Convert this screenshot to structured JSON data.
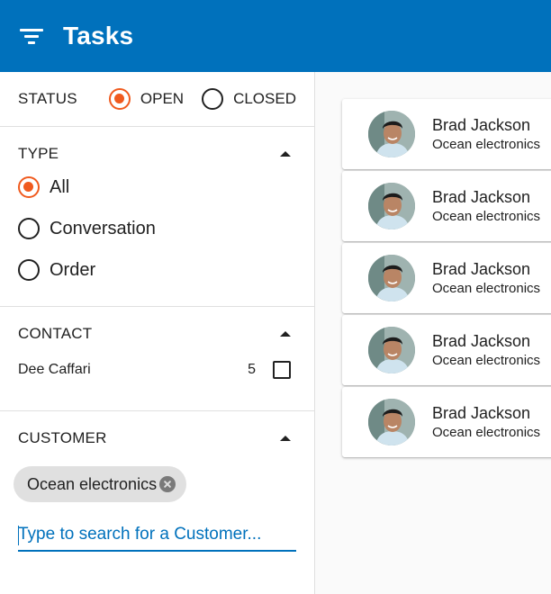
{
  "app": {
    "title": "Tasks"
  },
  "status": {
    "label": "STATUS",
    "options": [
      {
        "label": "OPEN",
        "selected": true
      },
      {
        "label": "CLOSED",
        "selected": false
      }
    ]
  },
  "type": {
    "label": "TYPE",
    "options": [
      {
        "label": "All",
        "selected": true
      },
      {
        "label": "Conversation",
        "selected": false
      },
      {
        "label": "Order",
        "selected": false
      }
    ]
  },
  "contact": {
    "label": "CONTACT",
    "items": [
      {
        "name": "Dee Caffari",
        "count": "5",
        "checked": false
      }
    ]
  },
  "customer": {
    "label": "CUSTOMER",
    "chip": "Ocean electronics",
    "search_placeholder": "Type to search for a Customer...",
    "search_value": ""
  },
  "tasks": [
    {
      "name": "Brad Jackson",
      "company": "Ocean electronics"
    },
    {
      "name": "Brad Jackson",
      "company": "Ocean electronics"
    },
    {
      "name": "Brad Jackson",
      "company": "Ocean electronics"
    },
    {
      "name": "Brad Jackson",
      "company": "Ocean electronics"
    },
    {
      "name": "Brad Jackson",
      "company": "Ocean electronics"
    }
  ],
  "colors": {
    "app_bar": "#0071bc",
    "accent": "#f05a1e",
    "chip": "#e0e0e0"
  },
  "icons": {
    "menu": "filter-list-icon",
    "collapse": "caret-up-icon",
    "chip_remove": "cancel-icon"
  }
}
